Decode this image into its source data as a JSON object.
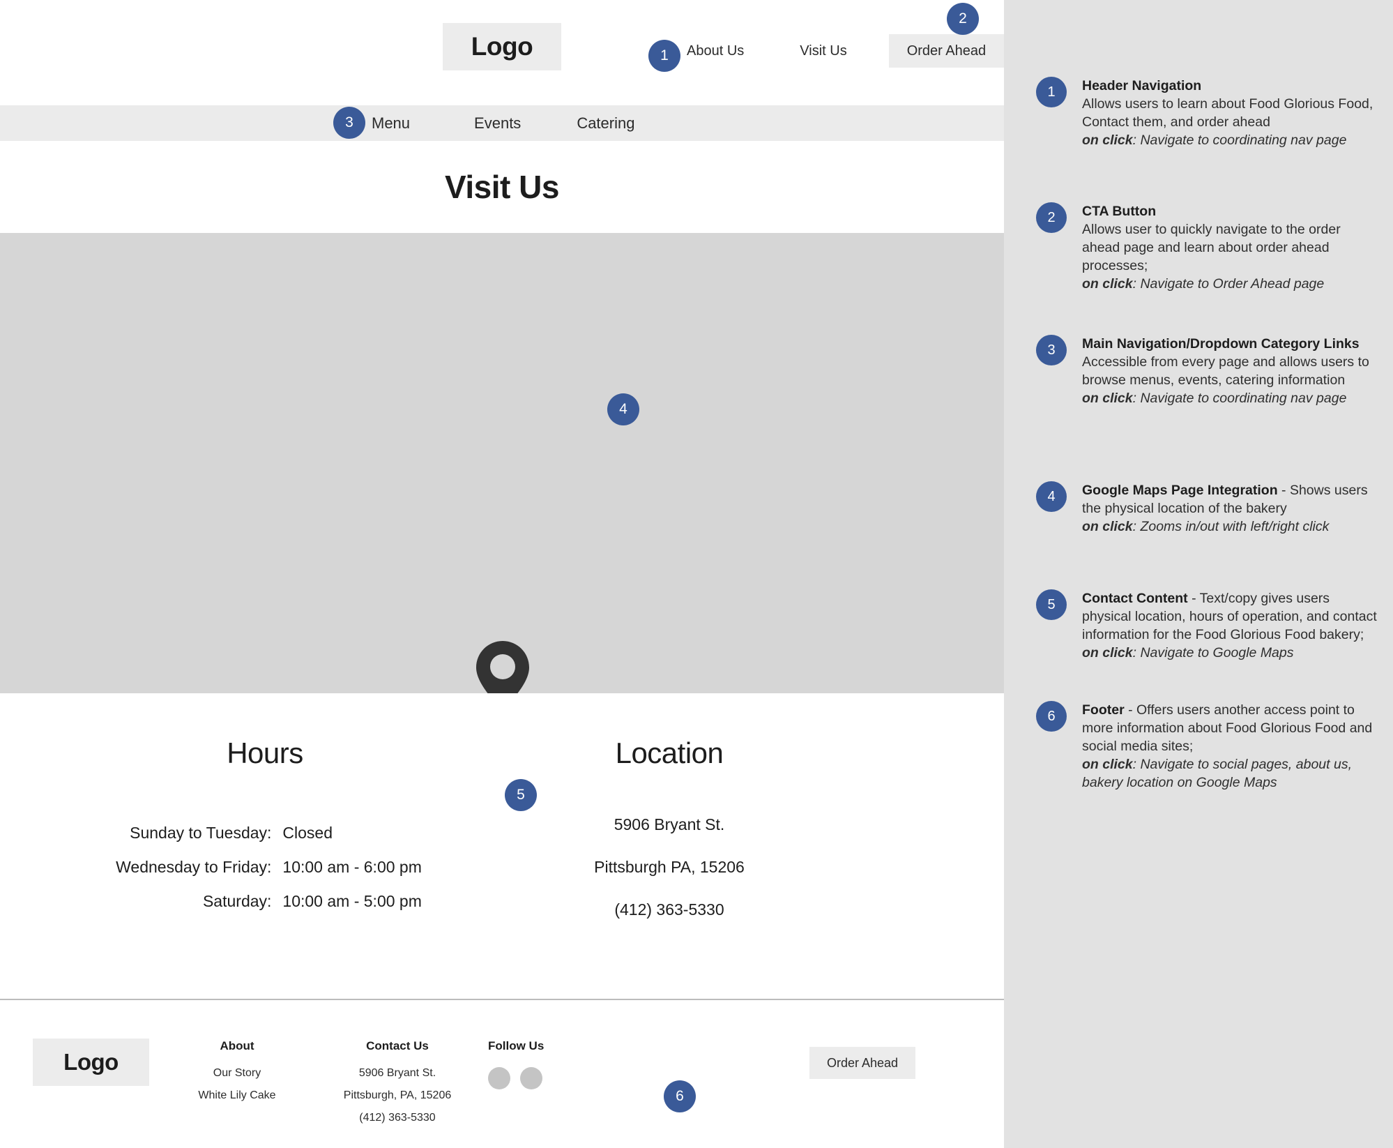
{
  "brand": {
    "accent_blue": "#3a5a98",
    "panel_bg": "#e2e2e2",
    "map_bg": "#d6d6d6",
    "chip_bg": "#ececec"
  },
  "header": {
    "logo": "Logo",
    "nav": [
      {
        "label": "About Us"
      },
      {
        "label": "Visit Us"
      }
    ],
    "cta_label": "Order Ahead"
  },
  "subnav": {
    "items": [
      {
        "label": "Menu"
      },
      {
        "label": "Events"
      },
      {
        "label": "Catering"
      }
    ]
  },
  "page": {
    "title": "Visit Us"
  },
  "map": {
    "pin_icon": "map-pin-icon"
  },
  "hours": {
    "heading": "Hours",
    "rows": [
      {
        "label": "Sunday to Tuesday:",
        "value": "Closed"
      },
      {
        "label": "Wednesday to Friday:",
        "value": "10:00 am - 6:00 pm"
      },
      {
        "label": "Saturday:",
        "value": "10:00 am - 5:00 pm"
      }
    ]
  },
  "location": {
    "heading": "Location",
    "street": "5906 Bryant St.",
    "city_state_zip": "Pittsburgh PA, 15206",
    "phone": "(412) 363-5330"
  },
  "footer": {
    "logo": "Logo",
    "about": {
      "heading": "About",
      "links": [
        {
          "label": "Our Story"
        },
        {
          "label": "White Lily Cake"
        }
      ]
    },
    "contact": {
      "heading": "Contact Us",
      "lines": [
        {
          "text": "5906 Bryant St."
        },
        {
          "text": "Pittsburgh, PA, 15206"
        },
        {
          "text": "(412) 363-5330"
        }
      ]
    },
    "follow": {
      "heading": "Follow Us",
      "icons": [
        {
          "name": "social-icon-1"
        },
        {
          "name": "social-icon-2"
        }
      ]
    },
    "cta_label": "Order Ahead"
  },
  "callouts": {
    "header_nav": "1",
    "cta_button": "2",
    "main_nav": "3",
    "map": "4",
    "contact_content": "5",
    "footer": "6"
  },
  "annotations": [
    {
      "number": "1",
      "title": "Header Navigation",
      "desc": "Allows users to learn about Food Glorious Food, Contact them, and order ahead",
      "on_click_label": "on click",
      "on_click": ": Navigate to coordinating nav page"
    },
    {
      "number": "2",
      "title": "CTA Button",
      "desc": "Allows user to quickly navigate to the order ahead page and learn about order ahead processes;",
      "on_click_label": "on click",
      "on_click": ": Navigate to Order Ahead page"
    },
    {
      "number": "3",
      "title": "Main Navigation/Dropdown Category Links",
      "desc": "Accessible from every page and allows users to browse menus, events, catering information",
      "on_click_label": "on click",
      "on_click": ": Navigate to coordinating nav page"
    },
    {
      "number": "4",
      "title": "Google Maps Page Integration",
      "desc": " - Shows users the physical location of the bakery",
      "on_click_label": "on click",
      "on_click": ": Zooms in/out with left/right click"
    },
    {
      "number": "5",
      "title": "Contact Content",
      "desc": " - Text/copy gives users physical location, hours of operation, and contact information for the Food Glorious Food bakery;",
      "on_click_label": "on click",
      "on_click": ": Navigate to Google Maps"
    },
    {
      "number": "6",
      "title": "Footer",
      "desc": " - Offers users another access point to more information about Food Glorious Food and social media sites;",
      "on_click_label": "on click",
      "on_click": ": Navigate to social pages, about us, bakery location on Google Maps"
    }
  ]
}
